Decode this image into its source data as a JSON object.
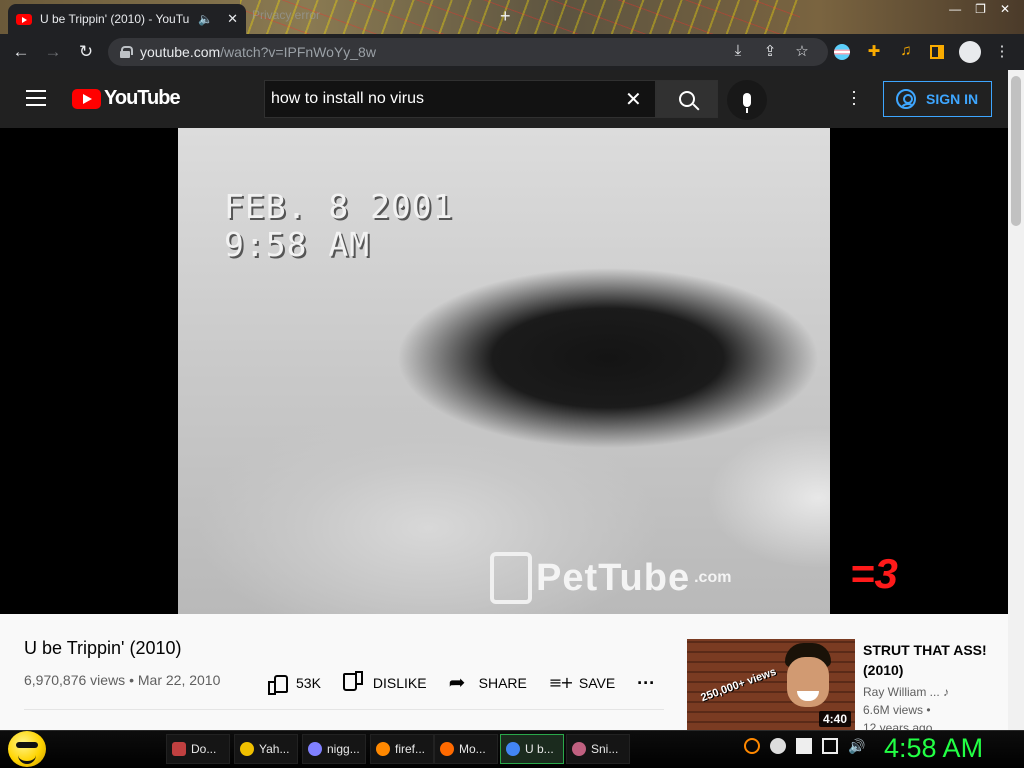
{
  "browser": {
    "tab_title": "U be Trippin' (2010) - YouTube",
    "tab2_title": "Privacy error",
    "url_host": "youtube.com",
    "url_path": "/watch?v=IPFnWoYy_8w"
  },
  "youtube": {
    "logo_text": "YouTube",
    "search_value": "how to install no virus",
    "signin_label": "SIGN IN"
  },
  "video": {
    "overlay_date": "FEB. 8 2001",
    "overlay_time": "9:58 AM",
    "watermark": "PetTube",
    "watermark_suffix": ".com",
    "emote": "=3",
    "title": "U be Trippin' (2010)",
    "views": "6,970,876 views",
    "date": "Mar 22, 2010",
    "actions": {
      "like_count": "53K",
      "dislike_label": "DISLIKE",
      "share_label": "SHARE",
      "save_label": "SAVE"
    }
  },
  "related": {
    "title": "STRUT THAT ASS! (2010)",
    "channel": "Ray William ...",
    "views": "6.6M views •",
    "age": "12 years ago",
    "badge": "250,000+ views",
    "duration": "4:40"
  },
  "taskbar": {
    "items": [
      {
        "label": "Do...",
        "color": "#c04040"
      },
      {
        "label": "Yah...",
        "color": "#f0c000"
      },
      {
        "label": "nigg...",
        "color": "#8080ff"
      },
      {
        "label": "firef...",
        "color": "#ff8800"
      },
      {
        "label": "Mo...",
        "color": "#ff6a00"
      },
      {
        "label": "U b...",
        "color": "#4285f4"
      },
      {
        "label": "Sni...",
        "color": "#c06080"
      }
    ],
    "clock": "4:58 AM"
  }
}
